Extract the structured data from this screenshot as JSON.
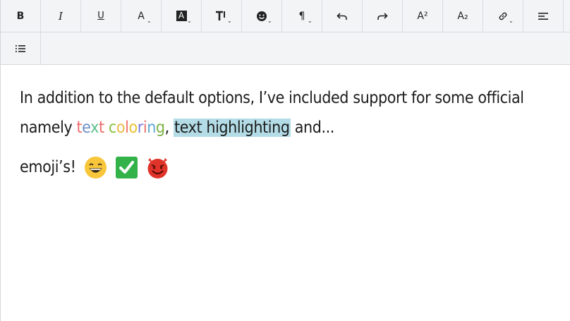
{
  "toolbar": {
    "row1": [
      {
        "name": "bold-button",
        "label": "B"
      },
      {
        "name": "italic-button",
        "label": "I"
      },
      {
        "name": "underline-button",
        "label": "U"
      },
      {
        "name": "text-color-button",
        "label": "A"
      },
      {
        "name": "highlight-color-button",
        "label": "A"
      },
      {
        "name": "font-size-button",
        "label": "T"
      },
      {
        "name": "emoji-button"
      },
      {
        "name": "paragraph-button",
        "label": "¶"
      },
      {
        "name": "undo-button"
      },
      {
        "name": "redo-button"
      },
      {
        "name": "superscript-button",
        "label": "A²"
      },
      {
        "name": "subscript-button",
        "label": "A₂"
      },
      {
        "name": "link-button"
      },
      {
        "name": "align-button"
      }
    ],
    "row2": [
      {
        "name": "list-button"
      }
    ]
  },
  "content": {
    "line1": "In addition to the default options, I’ve included support for some official",
    "line2": {
      "prefix": "namely ",
      "colored": "text coloring",
      "colors": [
        "#f0686b",
        "#6f8fc9",
        "#5bc08d",
        "#ea6b68",
        "#ffffff",
        "#8bc34a",
        "#e9b949",
        "#ef6f6c",
        "#e8c232",
        "#7a7ae0",
        "#ea6b68",
        "#5fa8d6",
        "#7cb342"
      ],
      "sep": ", ",
      "highlighted": "text highlighting",
      "highlight_color": "#b3dce6",
      "suffix": " and..."
    },
    "line3": "emoji’s!",
    "emojis": [
      "grinning-face",
      "check-mark-box",
      "smiling-devil"
    ]
  }
}
